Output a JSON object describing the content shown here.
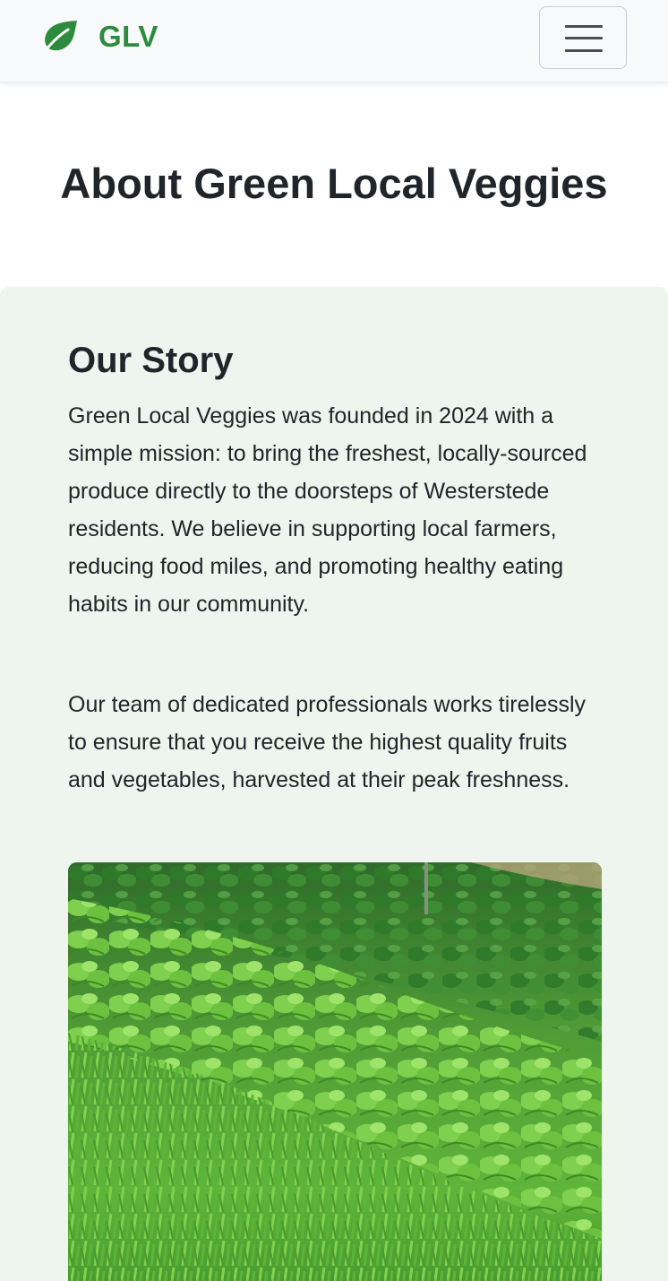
{
  "navbar": {
    "brand_icon": "leaf-icon",
    "brand_text": "GLV",
    "toggler_icon": "hamburger-menu-icon",
    "brand_color": "#2e8b3d"
  },
  "page": {
    "title": "About Green Local Veggies"
  },
  "story": {
    "heading": "Our Story",
    "paragraphs": [
      "Green Local Veggies was founded in 2024 with a simple mission: to bring the freshest, locally-sourced produce directly to the doorsteps of Westerstede residents. We believe in supporting local farmers, reducing food miles, and promoting healthy eating habits in our community.",
      "Our team of dedicated professionals works tirelessly to ensure that you receive the highest quality fruits and vegetables, harvested at their peak freshness."
    ],
    "background_color": "#eef5ef"
  }
}
